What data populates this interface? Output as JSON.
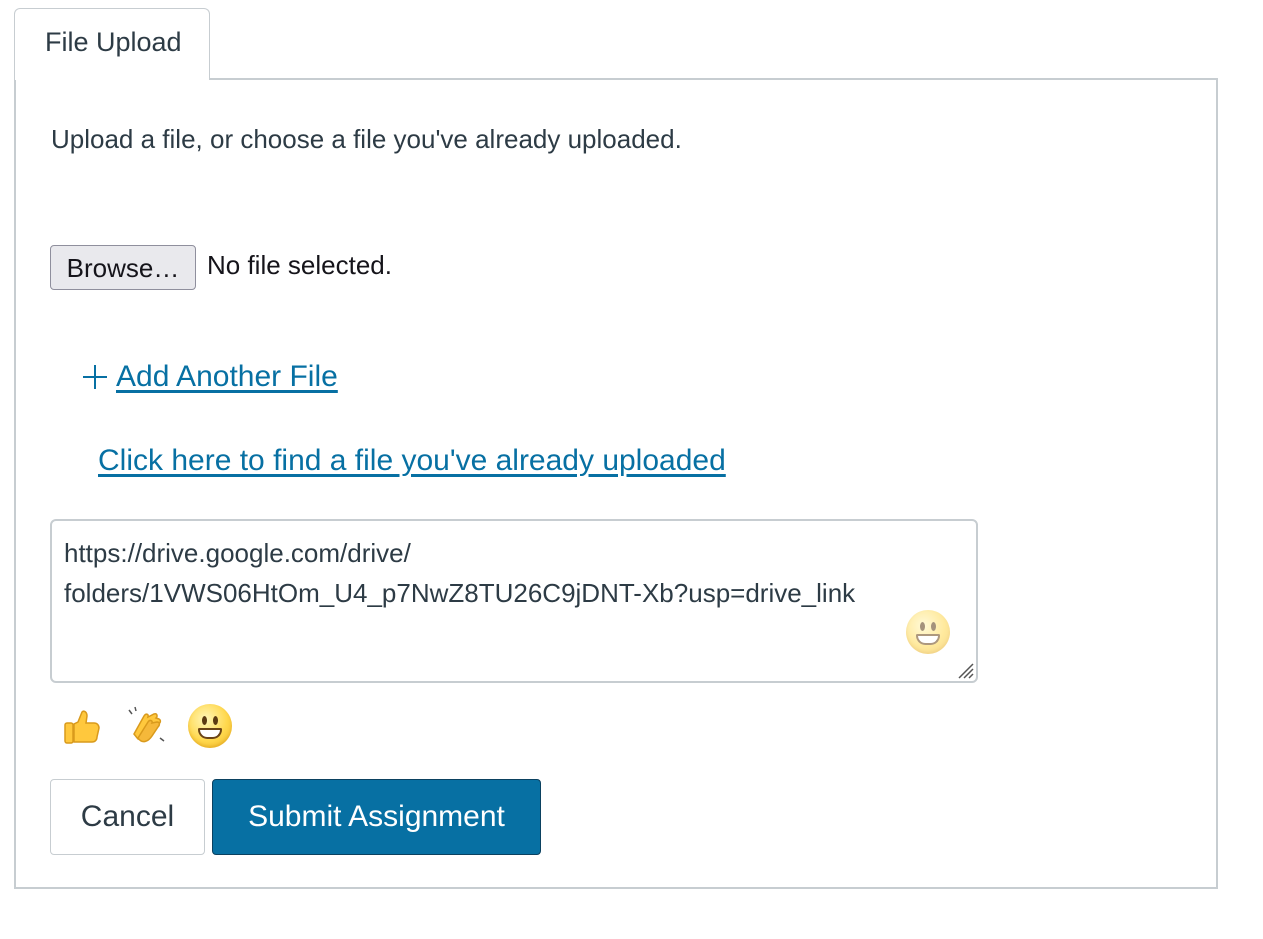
{
  "tabs": [
    {
      "label": "File Upload",
      "active": true
    }
  ],
  "upload": {
    "instructions": "Upload a file, or choose a file you've already uploaded.",
    "browse_label": "Browse…",
    "no_file_text": "No file selected.",
    "add_another_label": " Add Another File",
    "find_uploaded_label": "Click here to find a file you've already uploaded"
  },
  "comment": {
    "value": "https://drive.google.com/drive/\nfolders/1VWS06HtOm_U4_p7NwZ8TU26C9jDNT-Xb?usp=drive_link",
    "emoji_picker_icon": "grinning-face-icon"
  },
  "reactions": [
    {
      "icon": "thumbs-up-icon",
      "glyph": "👍"
    },
    {
      "icon": "clapping-hands-icon",
      "glyph": "👏"
    },
    {
      "icon": "grinning-face-icon",
      "glyph": "😀"
    }
  ],
  "actions": {
    "cancel_label": "Cancel",
    "submit_label": "Submit Assignment"
  },
  "colors": {
    "link": "#0770a3",
    "primary_button": "#0770a3",
    "border": "#c7cdd1",
    "text": "#2d3b45"
  }
}
